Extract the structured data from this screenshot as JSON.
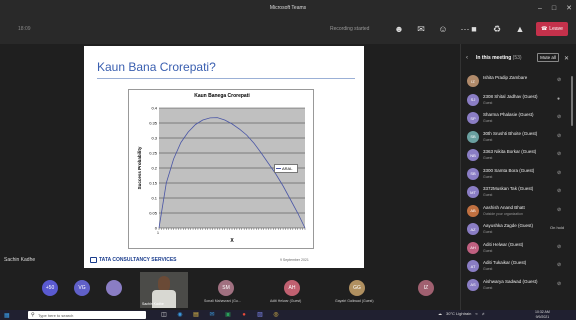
{
  "window": {
    "title": "Microsoft Teams",
    "controls": [
      "–",
      "□",
      "✕"
    ]
  },
  "toolbar": {
    "left_text": "18:09",
    "recording_label": "Recording started",
    "icons": [
      "people-icon",
      "chat-icon",
      "reactions-icon",
      "more-icon"
    ],
    "devices": [
      "camera-icon",
      "mic-icon",
      "share-icon"
    ],
    "leave_label": "Leave"
  },
  "slide": {
    "title": "Kaun Bana Crorepati?",
    "footer_brand": "TATA CONSULTANCY SERVICES",
    "footer_date": "9 September 2021"
  },
  "chart_data": {
    "type": "line",
    "title": "Kaun Banega Crorepati",
    "xlabel": "X",
    "ylabel": "Success Probability",
    "ylim": [
      0,
      0.4
    ],
    "yticks": [
      "0",
      "0.05",
      "0.1",
      "0.15",
      "0.2",
      "0.25",
      "0.3",
      "0.35",
      "0.4"
    ],
    "xtick_first": "1",
    "grid": true,
    "legend": "right",
    "series": [
      {
        "name": "ARAL",
        "color": "#4a56a6",
        "x": [
          0,
          0.05,
          0.1,
          0.15,
          0.2,
          0.25,
          0.3,
          0.35,
          0.4,
          0.45,
          0.5,
          0.55,
          0.6,
          0.65,
          0.7,
          0.75,
          0.8,
          0.85,
          0.9,
          0.95,
          1
        ],
        "y": [
          0,
          0.15,
          0.23,
          0.285,
          0.32,
          0.345,
          0.36,
          0.367,
          0.368,
          0.36,
          0.347,
          0.33,
          0.31,
          0.283,
          0.25,
          0.215,
          0.18,
          0.14,
          0.095,
          0.05,
          0
        ]
      }
    ]
  },
  "presenter_name": "Sachin Kadhe",
  "people_panel": {
    "title": "In this meeting",
    "count": "(53)",
    "mute_all_label": "Mute all",
    "participants": [
      {
        "name": "Ishita Pradip Zambare",
        "sub": "",
        "initials": "IZ",
        "color": "#b08a6a",
        "status": "mic-off"
      },
      {
        "name": "2308 Shital Jadhav (Guest)",
        "sub": "Guest",
        "initials": "SJ",
        "color": "#8a7dc4",
        "status": "mic-on"
      },
      {
        "name": "Sharma Phalasie (Guest)",
        "sub": "Guest",
        "initials": "SP",
        "color": "#8a7dc4",
        "status": "mic-off"
      },
      {
        "name": "30th Srushti Bhoite (Guest)",
        "sub": "Guest",
        "initials": "SB",
        "color": "#6aa0a0",
        "status": "mic-off"
      },
      {
        "name": "3363 Nikita Borkar (Guest)",
        "sub": "Guest",
        "initials": "NB",
        "color": "#8a7dc4",
        "status": "mic-off"
      },
      {
        "name": "3300 Samta Bora (Guest)",
        "sub": "Guest",
        "initials": "SB",
        "color": "#8a7dc4",
        "status": "mic-off"
      },
      {
        "name": "3372Muskan Tak (Guest)",
        "sub": "Guest",
        "initials": "MT",
        "color": "#8a7dc4",
        "status": "mic-off"
      },
      {
        "name": "Aashish Anand Bhatt",
        "sub": "Outside your organization",
        "initials": "AB",
        "color": "#c07040",
        "status": "mic-off"
      },
      {
        "name": "Aayushka Zagde (Guest)",
        "sub": "Guest",
        "initials": "AZ",
        "color": "#8a7dc4",
        "status": "On hold"
      },
      {
        "name": "Aditi Helwar (Guest)",
        "sub": "Guest",
        "initials": "AH",
        "color": "#c06080",
        "status": "mic-off"
      },
      {
        "name": "Aditi Tukaikar (Guest)",
        "sub": "Guest",
        "initials": "AT",
        "color": "#8a7dc4",
        "status": "mic-off"
      },
      {
        "name": "Aishwarya Sadwad (Guest)",
        "sub": "Guest",
        "initials": "AS",
        "color": "#8a7dc4",
        "status": "mic-off"
      }
    ]
  },
  "gallery": [
    {
      "initials": "+50",
      "label": "",
      "color": "#5a5ad0"
    },
    {
      "initials": "VG",
      "label": "",
      "color": "#6060c8"
    },
    {
      "initials": "",
      "label": "",
      "color": "#8a7dc4"
    },
    {
      "initials": "SM",
      "label": "Sonali Mahavrani (Gu...",
      "color": "#a07080"
    },
    {
      "initials": "AH",
      "label": "Aditi Helwar (Guest)",
      "color": "#c06070"
    },
    {
      "initials": "GG",
      "label": "Gayatri Gaikwad (Guest)",
      "color": "#b09060"
    },
    {
      "initials": "IZ",
      "label": "",
      "color": "#a06070"
    }
  ],
  "video_tile_label": "Sachin Kadhe",
  "taskbar": {
    "search_placeholder": "Type here to search",
    "weather": "30°C Lightrain",
    "time": "10:32 AM",
    "date": "9/9/2021"
  }
}
